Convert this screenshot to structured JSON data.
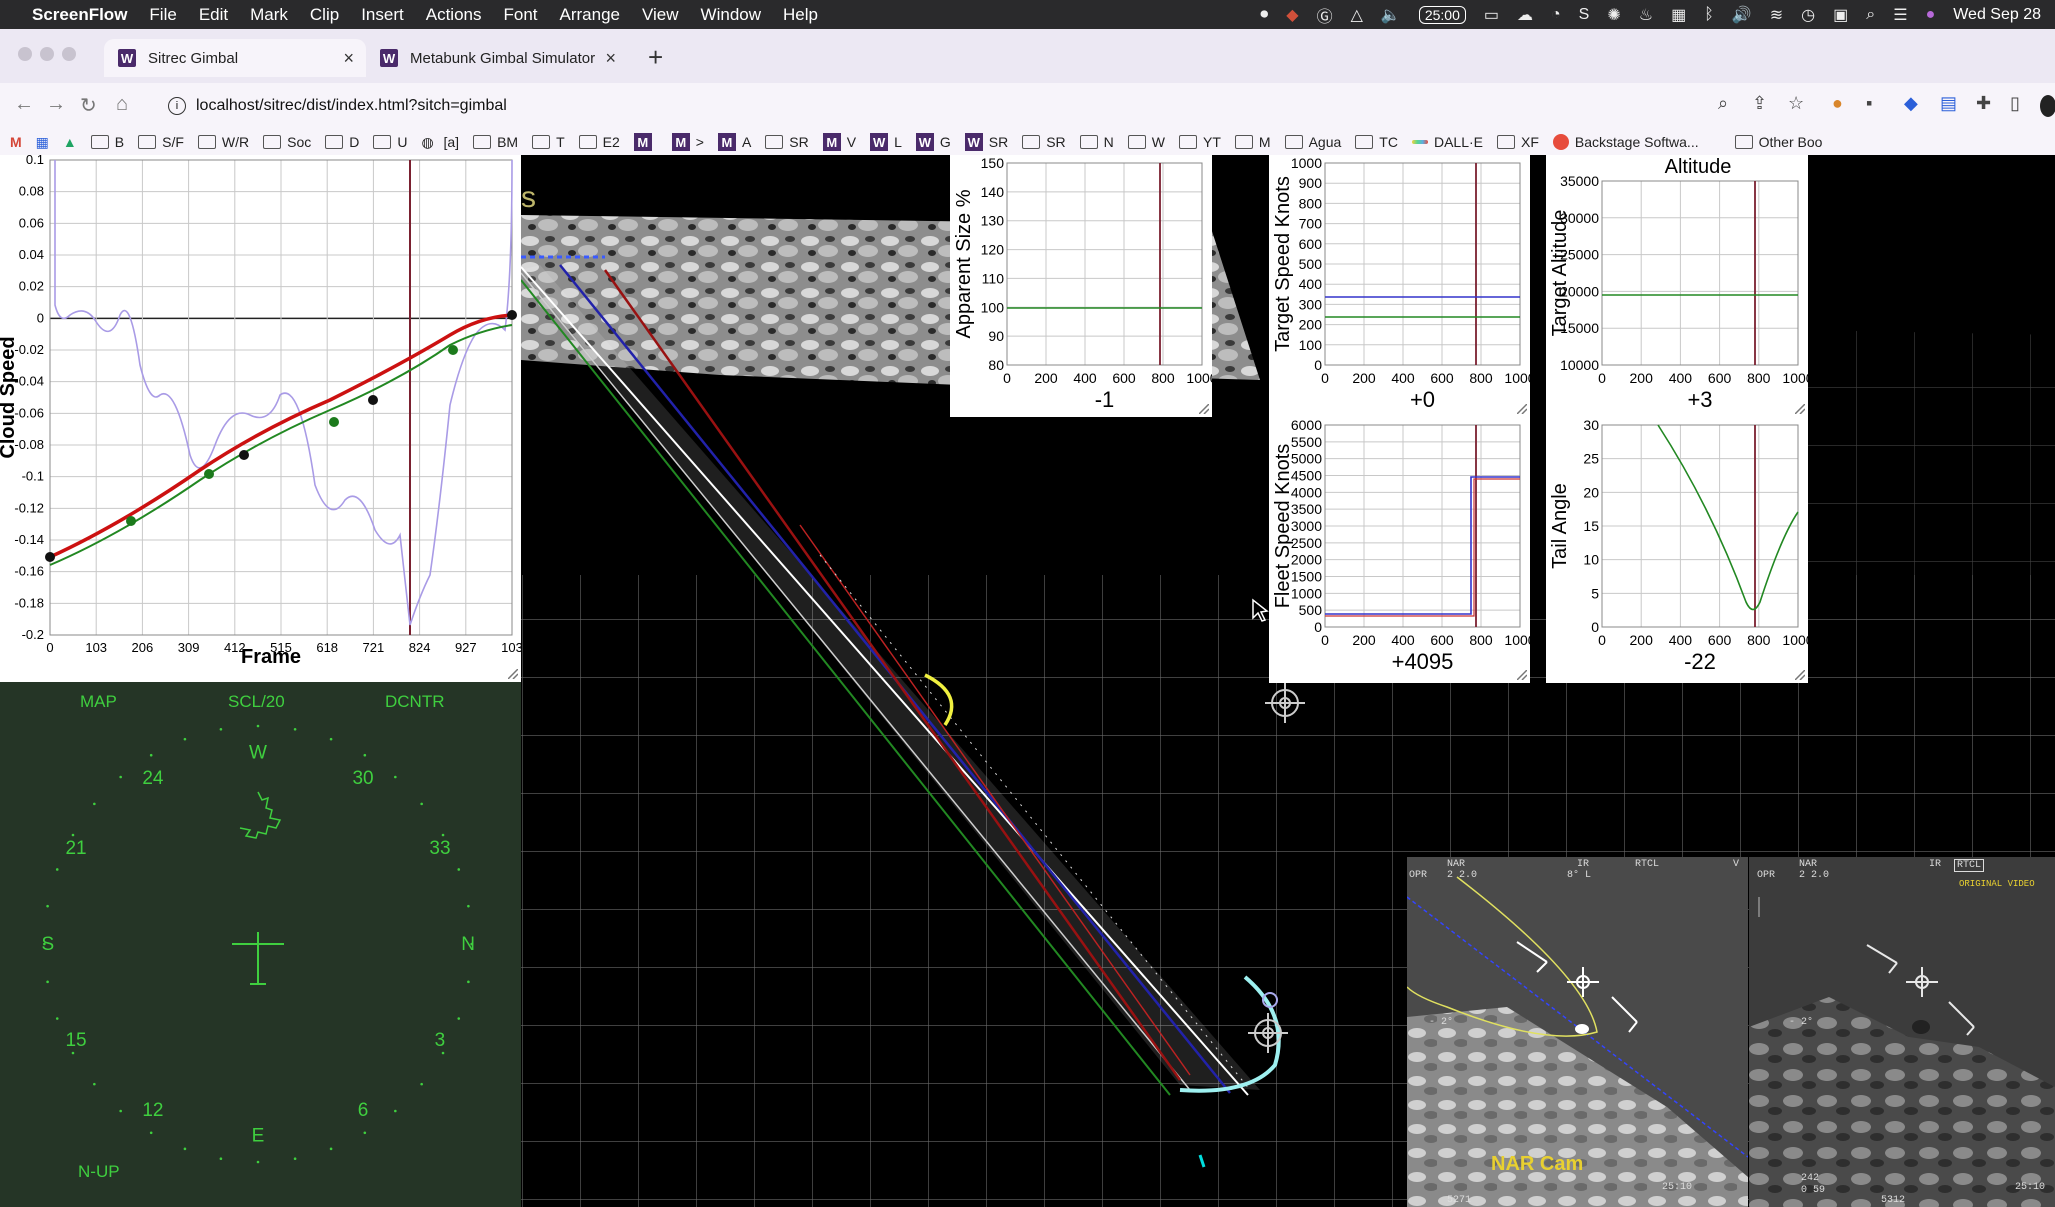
{
  "menubar": {
    "app": "ScreenFlow",
    "items": [
      "File",
      "Edit",
      "Mark",
      "Clip",
      "Insert",
      "Actions",
      "Font",
      "Arrange",
      "View",
      "Window",
      "Help"
    ],
    "timer": "25:00",
    "datetime": "Wed Sep 28"
  },
  "tabs": [
    {
      "label": "Sitrec Gimbal",
      "favicon": "W"
    },
    {
      "label": "Metabunk Gimbal Simulator",
      "favicon": "W"
    }
  ],
  "address": {
    "url": "localhost/sitrec/dist/index.html?sitch=gimbal"
  },
  "bookmarks": [
    {
      "type": "folder",
      "label": "B"
    },
    {
      "type": "folder",
      "label": "S/F"
    },
    {
      "type": "folder",
      "label": "W/R"
    },
    {
      "type": "folder",
      "label": "Soc"
    },
    {
      "type": "folder",
      "label": "D"
    },
    {
      "type": "folder",
      "label": "U"
    },
    {
      "type": "globe",
      "label": "[a]"
    },
    {
      "type": "folder",
      "label": "BM"
    },
    {
      "type": "folder",
      "label": "T"
    },
    {
      "type": "folder",
      "label": "E2"
    },
    {
      "type": "m",
      "label": ""
    },
    {
      "type": "m",
      "label": ">"
    },
    {
      "type": "m",
      "label": "A"
    },
    {
      "type": "folder",
      "label": "SR"
    },
    {
      "type": "m",
      "label": "V"
    },
    {
      "type": "w",
      "label": "L"
    },
    {
      "type": "w",
      "label": "G"
    },
    {
      "type": "w",
      "label": "SR"
    },
    {
      "type": "folder",
      "label": "SR"
    },
    {
      "type": "folder",
      "label": "N"
    },
    {
      "type": "folder",
      "label": "W"
    },
    {
      "type": "folder",
      "label": "YT"
    },
    {
      "type": "folder",
      "label": "M"
    },
    {
      "type": "folder",
      "label": "Agua"
    },
    {
      "type": "folder",
      "label": "TC"
    },
    {
      "type": "dalle",
      "label": "DALL·E"
    },
    {
      "type": "folder",
      "label": "XF"
    },
    {
      "type": "backstage",
      "label": "Backstage Softwa..."
    },
    {
      "type": "folder",
      "label": "Other Boo"
    }
  ],
  "scene": {
    "partial_label": "s"
  },
  "cloud_graph": {
    "ylabel": "Cloud Speed",
    "xlabel": "Frame",
    "yticks": [
      "0.1",
      "0.08",
      "0.06",
      "0.04",
      "0.02",
      "0",
      "-0.02",
      "-0.04",
      "-0.06",
      "-0.08",
      "-0.1",
      "-0.12",
      "-0.14",
      "-0.16",
      "-0.18",
      "-0.2"
    ],
    "xticks": [
      "0",
      "103",
      "206",
      "309",
      "412",
      "515",
      "618",
      "721",
      "824",
      "927",
      "103"
    ]
  },
  "small_graphs": [
    {
      "id": "apparent-size",
      "ylabel": "Apparent Size %",
      "title": "",
      "value": "-1",
      "yticks": [
        "150",
        "140",
        "130",
        "120",
        "110",
        "100",
        "90",
        "80"
      ],
      "xticks": [
        "0",
        "200",
        "400",
        "600",
        "800",
        "1000"
      ]
    },
    {
      "id": "target-speed",
      "ylabel": "Target Speed Knots",
      "title": "",
      "value": "+0",
      "yticks": [
        "1000",
        "900",
        "800",
        "700",
        "600",
        "500",
        "400",
        "300",
        "200",
        "100",
        "0"
      ],
      "xticks": [
        "0",
        "200",
        "400",
        "600",
        "800",
        "1000"
      ]
    },
    {
      "id": "target-altitude",
      "ylabel": "Target Altitude",
      "title": "Altitude",
      "value": "+3",
      "yticks": [
        "35000",
        "30000",
        "25000",
        "20000",
        "15000",
        "10000"
      ],
      "xticks": [
        "0",
        "200",
        "400",
        "600",
        "800",
        "1000"
      ]
    },
    {
      "id": "fleet-speed",
      "ylabel": "Fleet Speed Knots",
      "title": "",
      "value": "+4095",
      "yticks": [
        "6000",
        "5500",
        "5000",
        "4500",
        "4000",
        "3500",
        "3000",
        "2500",
        "2000",
        "1500",
        "1000",
        "500",
        "0"
      ],
      "xticks": [
        "0",
        "200",
        "400",
        "600",
        "800",
        "1000"
      ]
    },
    {
      "id": "tail-angle",
      "ylabel": "Tail Angle",
      "title": "",
      "value": "-22",
      "yticks": [
        "30",
        "25",
        "20",
        "15",
        "10",
        "5",
        "0"
      ],
      "xticks": [
        "0",
        "200",
        "400",
        "600",
        "800",
        "1000"
      ]
    }
  ],
  "radar": {
    "top_labels": [
      "MAP",
      "SCL/20",
      "DCNTR"
    ],
    "bottom_label": "N-UP",
    "compass": [
      "W",
      "30",
      "33",
      "N",
      "3",
      "6",
      "E",
      "12",
      "15",
      "S",
      "21",
      "24"
    ]
  },
  "narcam": {
    "title": "NAR Cam",
    "hud": [
      "NAR",
      "2 2.0",
      "IR",
      "8° L",
      "RTCL",
      "OPR",
      "V",
      "- 2°",
      "25:10",
      "5271"
    ]
  },
  "origcam": {
    "hud": [
      "NAR",
      "2 2.0",
      "IR",
      "RTCL",
      "ORIGINAL VIDEO",
      "OPR",
      "- 2°",
      "242",
      "0 59",
      "5312",
      "25:10"
    ]
  },
  "colors": {
    "accent_purple": "#4a2a6a",
    "radar_green": "#3fcf3f",
    "radar_bg": "#253526",
    "track_yellow": "#f0f040",
    "track_cyan": "#9ef0f0"
  }
}
